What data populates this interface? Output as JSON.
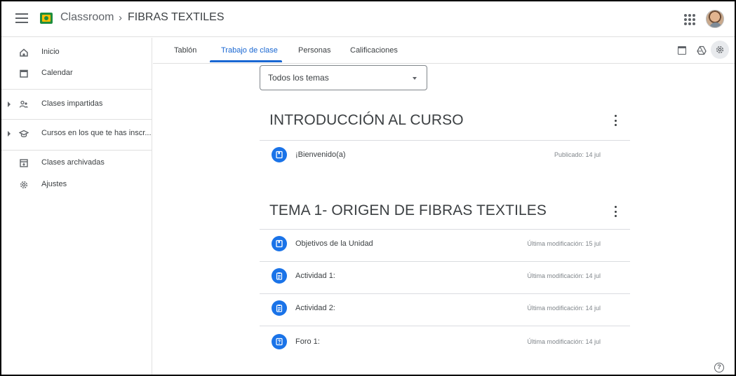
{
  "header": {
    "app_title": "Classroom",
    "separator": "›",
    "course_title": "FIBRAS TEXTILES"
  },
  "sidebar": {
    "items": [
      {
        "label": "Inicio",
        "icon": "home-icon"
      },
      {
        "label": "Calendar",
        "icon": "calendar-icon"
      },
      {
        "label": "Clases impartidas",
        "icon": "people-icon"
      },
      {
        "label": "Cursos en los que te has inscr...",
        "icon": "school-icon"
      },
      {
        "label": "Clases archivadas",
        "icon": "archive-icon"
      },
      {
        "label": "Ajustes",
        "icon": "gear-icon"
      }
    ]
  },
  "tabs": [
    {
      "label": "Tablón"
    },
    {
      "label": "Trabajo de clase",
      "active": true
    },
    {
      "label": "Personas"
    },
    {
      "label": "Calificaciones"
    }
  ],
  "topic_filter": {
    "selected": "Todos los temas"
  },
  "topics": [
    {
      "title": "INTRODUCCIÓN AL CURSO",
      "items": [
        {
          "title": "¡Bienvenido(a)",
          "meta": "Publicado: 14 jul",
          "icon": "material-icon"
        }
      ]
    },
    {
      "title": "TEMA 1- ORIGEN DE FIBRAS TEXTILES",
      "items": [
        {
          "title": "Objetivos de la Unidad",
          "meta": "Última modificación: 15 jul",
          "icon": "material-icon"
        },
        {
          "title": "Actividad 1:",
          "meta": "Última modificación: 14 jul",
          "icon": "assignment-icon"
        },
        {
          "title": "Actividad 2:",
          "meta": "Última modificación: 14 jul",
          "icon": "assignment-icon"
        },
        {
          "title": "Foro 1:",
          "meta": "Última modificación: 14 jul",
          "icon": "question-icon"
        }
      ]
    }
  ],
  "help": {
    "glyph": "?"
  },
  "colors": {
    "accent": "#1967d2",
    "item_icon_bg": "#1a73e8",
    "logo_green": "#1e8e3e",
    "logo_yellow": "#fbbc04"
  }
}
